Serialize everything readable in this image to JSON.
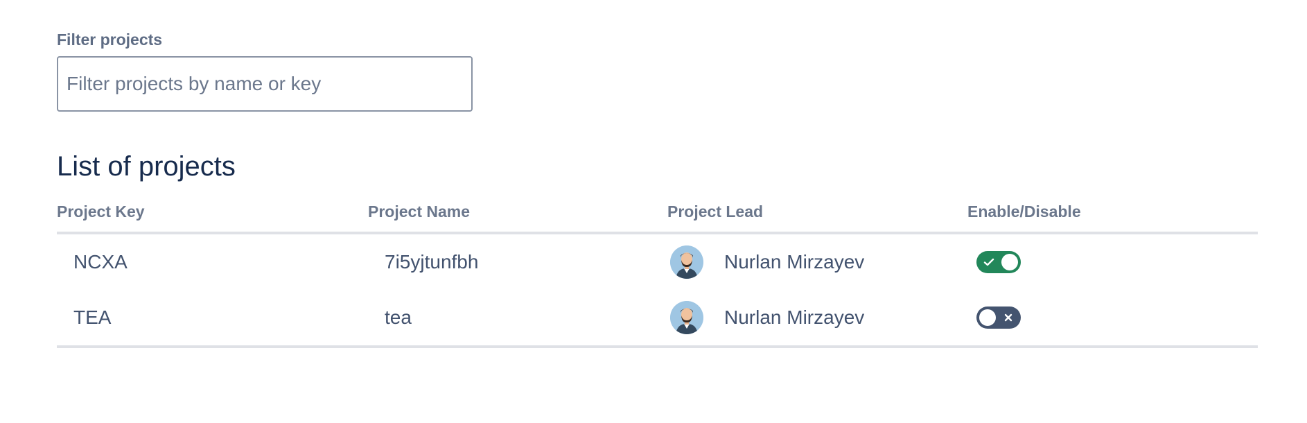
{
  "filter": {
    "label": "Filter projects",
    "placeholder": "Filter projects by name or key",
    "value": ""
  },
  "section_title": "List of projects",
  "table": {
    "columns": [
      "Project Key",
      "Project Name",
      "Project Lead",
      "Enable/Disable"
    ],
    "rows": [
      {
        "key": "NCXA",
        "name": "7i5yjtunfbh",
        "lead": "Nurlan Mirzayev",
        "enabled": true
      },
      {
        "key": "TEA",
        "name": "tea",
        "lead": "Nurlan Mirzayev",
        "enabled": false
      }
    ]
  },
  "colors": {
    "toggle_on": "#22875a",
    "toggle_off": "#44546f",
    "avatar_bg": "#9fc6e3"
  },
  "icons": {
    "avatar": "person-avatar-icon",
    "toggle_on": "check-icon",
    "toggle_off": "close-icon"
  }
}
